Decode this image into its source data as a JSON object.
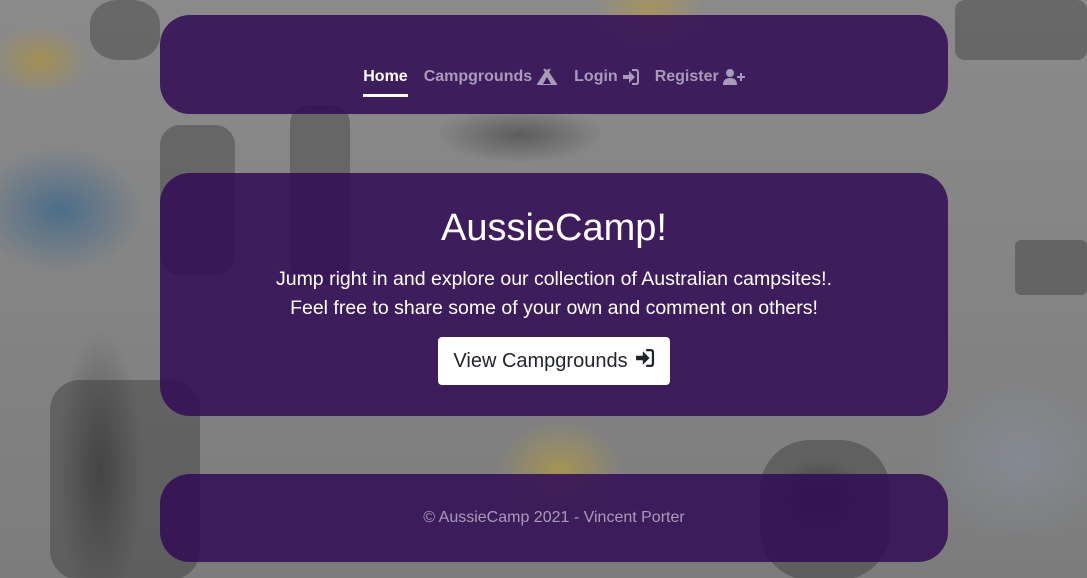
{
  "nav": {
    "items": [
      {
        "label": "Home",
        "icon": "",
        "active": true
      },
      {
        "label": "Campgrounds",
        "icon": "campground-icon",
        "active": false
      },
      {
        "label": "Login",
        "icon": "sign-in-icon",
        "active": false
      },
      {
        "label": "Register",
        "icon": "user-plus-icon",
        "active": false
      }
    ]
  },
  "hero": {
    "title": "AussieCamp!",
    "lead_line1": "Jump right in and explore our collection of Australian campsites!.",
    "lead_line2": "Feel free to share some of your own and comment on others!",
    "button_label": "View Campgrounds",
    "button_icon": "sign-in-icon"
  },
  "footer": {
    "text": "© AussieCamp 2021 - Vincent Porter"
  },
  "colors": {
    "card_bg": "#320c55",
    "nav_inactive": "#a99bb8",
    "nav_active": "#ffffff",
    "button_bg": "#ffffff",
    "button_text": "#212529"
  }
}
